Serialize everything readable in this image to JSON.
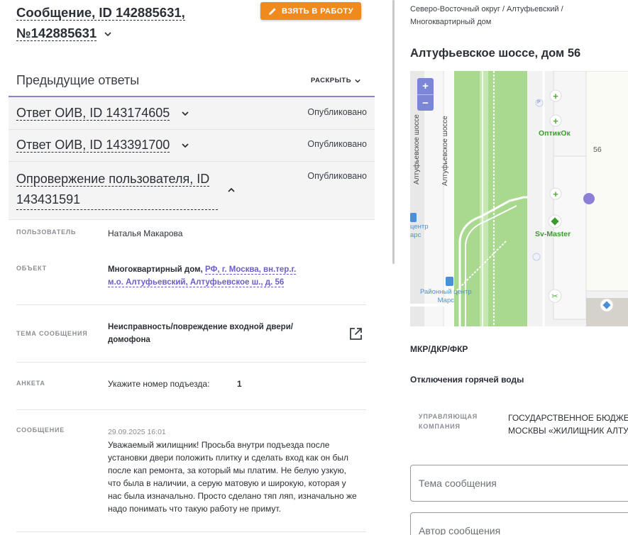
{
  "header": {
    "title": "Сообщение, ID 142885631,",
    "title2": "№142885631",
    "take_button": "ВЗЯТЬ В РАБОТУ"
  },
  "previous": {
    "title": "Предыдущие ответы",
    "expand_label": "РАСКРЫТЬ",
    "answers": [
      {
        "name": "Ответ ОИВ, ID 143174605",
        "status": "Опубликовано"
      },
      {
        "name": "Ответ ОИВ, ID 143391700",
        "status": "Опубликовано"
      },
      {
        "name_line1": "Опровержение пользователя, ID",
        "name_line2": "143431591",
        "status": "Опубликовано"
      }
    ]
  },
  "fields": {
    "user_label": "ПОЛЬЗОВАТЕЛЬ",
    "user_value": "Наталья Макарова",
    "object_label": "ОБЪЕКТ",
    "object_type": "Многоквартирный дом,",
    "object_link_line1": "РФ, г. Москва, вн.тер.г.",
    "object_link_line2": "м.о. Алтуфьевский, Алтуфьевское ш., д. 56",
    "topic_label": "ТЕМА СООБЩЕНИЯ",
    "topic_line1": "Неисправность/повреждение входной двери/",
    "topic_line2": "домофона",
    "survey_label": "АНКЕТА",
    "survey_question": "Укажите номер подъезда:",
    "survey_answer": "1",
    "message_label": "СООБЩЕНИЕ",
    "message_time": "29.09.2025 16:01",
    "message_lines": [
      "Уважаемый жилищник! Просьба внутри подъезда после",
      "установки двери положить плитку и сделать вход как он был",
      "после кап ремонта, за который мы платим. Не белую узкую,",
      "что была в наличии, а серую матовую и широкую, которая у",
      "нас была изначально. Просто сделано тяп ляп, изначально же",
      "надо понимать что такую работу не примут."
    ]
  },
  "right": {
    "crumb_line1": "Северо-Восточный округ / Алтуфьевский /",
    "crumb_line2": "Многоквартирный дом",
    "address": "Алтуфьевское шоссе, дом 56",
    "map": {
      "street_label": "Алтуфьевское шоссе",
      "street_label2": "Алтуфьевское шоссе",
      "poi_optik": "ОптикОк",
      "poi_svmaster": "Sv-Master",
      "poi_center_line1": "Районный центр",
      "poi_center_line2": "Марс",
      "poi_center_left_line1": "центр",
      "poi_center_left_line2": "арс",
      "house_number": "56",
      "zoom_in": "+",
      "zoom_out": "−",
      "parking_label": "P"
    },
    "mkr_label": "МКР/ДКР/ФКР",
    "hot_water_label": "Отключения горячей воды",
    "mc_label_line1": "УПРАВЛЯЮЩАЯ",
    "mc_label_line2": "КОМПАНИЯ",
    "mc_value_line1": "ГОСУДАРСТВЕННОЕ БЮДЖЕТ",
    "mc_value_line2": "МОСКВЫ «ЖИЛИЩНИК АЛТУ",
    "topic_input_placeholder": "Тема сообщения",
    "author_input_placeholder": "Автор сообщения"
  },
  "colors": {
    "accent": "#8a7fd6",
    "button": "#f08a1c",
    "link": "#6a5fc8",
    "map_green": "#a9d88f"
  }
}
